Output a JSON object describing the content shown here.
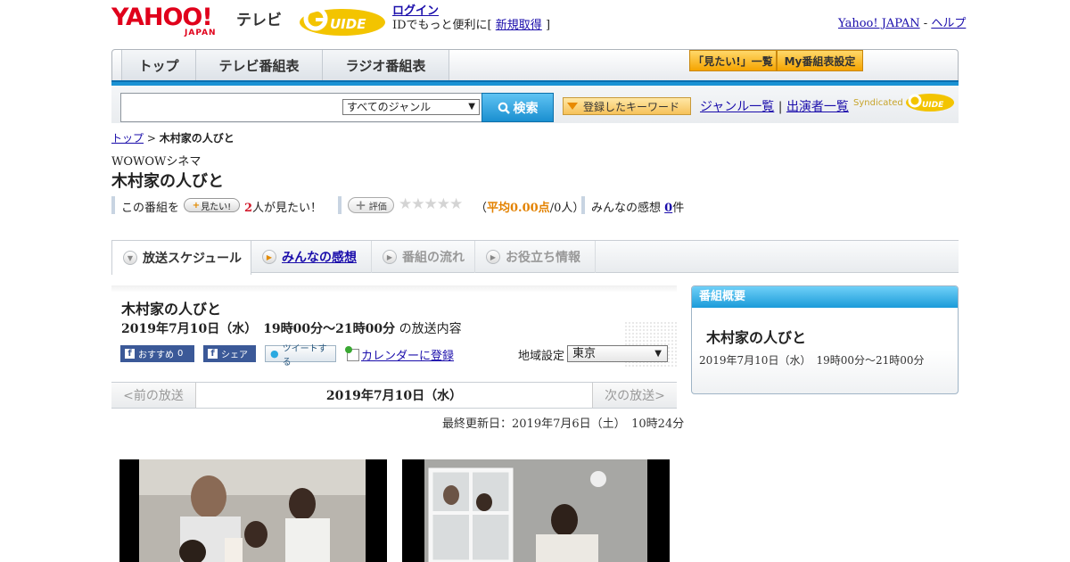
{
  "header": {
    "yahoo_logo": "YAHOO!",
    "yahoo_japan": "JAPAN",
    "tv_label": "テレビ",
    "login": "ログイン",
    "id_text": "IDでもっと便利に[",
    "register": "新規取得",
    "id_text_end": "]",
    "yahoo_japan_link": "Yahoo! JAPAN",
    "separator": "-",
    "help_link": "ヘルプ"
  },
  "nav": {
    "tabs": [
      {
        "label": "トップ"
      },
      {
        "label": "テレビ番組表"
      },
      {
        "label": "ラジオ番組表"
      }
    ],
    "mitai_list": "「見たい!」一覧",
    "my_bangumi": "My番組表設定"
  },
  "search": {
    "genre_selected": "すべてのジャンル",
    "button_label": "検索",
    "registered_keyword": "登録したキーワード",
    "genre_list": "ジャンル一覧",
    "divider": "|",
    "performers_list": "出演者一覧",
    "syndicated": "Syndicated"
  },
  "breadcrumb": {
    "top": "トップ",
    "sep": ">",
    "current": "木村家の人びと"
  },
  "program": {
    "channel": "WOWOWシネマ",
    "title": "木村家の人びと",
    "stats": {
      "prefix": "この番組を",
      "mitai_btn": "見たい!",
      "count": "2",
      "suffix": "人が見たい！",
      "hyouka_btn": "評価",
      "stars": "★★★★★",
      "avg_open": "（",
      "avg": "平均0.00点",
      "avg_people": "/0人）",
      "kansou_label": "みんなの感想",
      "kansou_count": "0",
      "kansou_unit": "件"
    }
  },
  "subtabs": [
    {
      "label": "放送スケジュール"
    },
    {
      "label": "みんなの感想"
    },
    {
      "label": "番組の流れ"
    },
    {
      "label": "お役立ち情報"
    }
  ],
  "main": {
    "title": "木村家の人びと",
    "air_datetime": "2019年7月10日（水）　19時00分～21時00分",
    "air_suffix": "の放送内容",
    "osusume": "おすすめ",
    "osusume_count": "0",
    "share": "シェア",
    "tweet": "ツイートする",
    "calendar": "カレンダーに登録",
    "region_label": "地域設定",
    "region_selected": "東京",
    "prev_air": "<前の放送",
    "day_label": "2019年7月10日（水）",
    "next_air": "次の放送>",
    "last_updated": "最終更新日：2019年7月6日（土）　10時24分"
  },
  "side": {
    "heading": "番組概要",
    "title": "木村家の人びと",
    "time": "2019年7月10日（水）　19時00分～21時00分"
  }
}
